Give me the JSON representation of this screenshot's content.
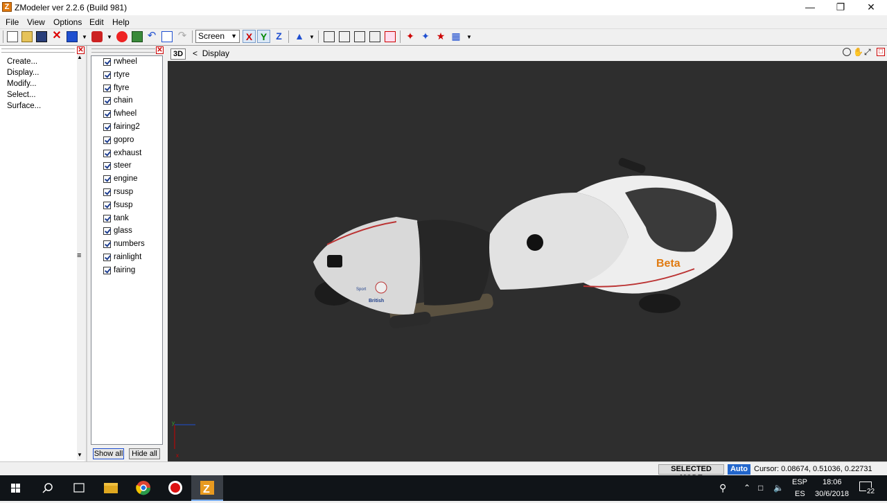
{
  "window": {
    "title": "ZModeler ver 2.2.6 (Build 981)"
  },
  "menu": [
    "File",
    "View",
    "Options",
    "Edit",
    "Help"
  ],
  "toolbar": {
    "view_mode": "Screen",
    "axes": [
      "X",
      "Y",
      "Z"
    ]
  },
  "commands": [
    "Create...",
    "Display...",
    "Modify...",
    "Select...",
    "Surface..."
  ],
  "objects": [
    "rwheel",
    "rtyre",
    "ftyre",
    "chain",
    "fwheel",
    "fairing2",
    "gopro",
    "exhaust",
    "steer",
    "engine",
    "rsusp",
    "fsusp",
    "tank",
    "glass",
    "numbers",
    "rainlight",
    "fairing"
  ],
  "object_buttons": {
    "show_all": "Show all",
    "hide_all": "Hide all"
  },
  "viewport": {
    "mode_label": "3D",
    "crumb_arrow": "<",
    "crumb": "Display",
    "axis_labels": [
      "y",
      "x"
    ]
  },
  "model_decals": {
    "brand": "Beta",
    "sponsor1": "Sport",
    "sponsor2": "British"
  },
  "statusbar": {
    "mode": "SELECTED MODE",
    "auto": "Auto",
    "cursor": "Cursor: 0.08674, 0.51036, 0.22731"
  },
  "taskbar": {
    "lang_top": "ESP",
    "lang_bottom": "ES",
    "time": "18:06",
    "date": "30/6/2018",
    "notifications": "22"
  },
  "colors": {
    "viewport_bg": "#2e2e2e",
    "accent": "#2266cc",
    "taskbar": "#101418"
  }
}
